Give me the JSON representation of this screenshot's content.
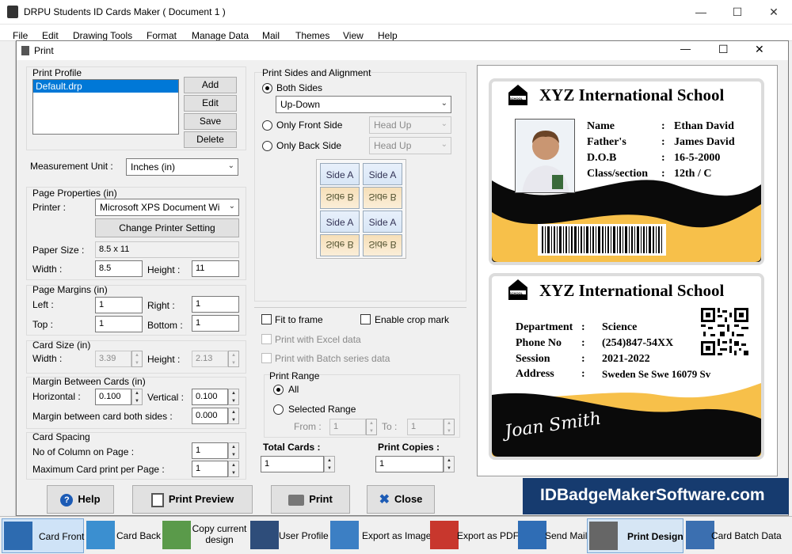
{
  "window": {
    "title": "DRPU Students ID Cards Maker ( Document 1 )"
  },
  "menu": [
    "File",
    "Edit",
    "Drawing Tools",
    "Format",
    "Manage Data",
    "Mail",
    "Themes",
    "View",
    "Help"
  ],
  "dialog": {
    "title": "Print"
  },
  "print_profile": {
    "label": "Print Profile",
    "items": [
      "Default.drp"
    ],
    "add": "Add",
    "edit": "Edit",
    "save": "Save",
    "delete": "Delete"
  },
  "measurement": {
    "label": "Measurement Unit :",
    "value": "Inches (in)"
  },
  "page_props": {
    "label": "Page Properties (in)",
    "printer_label": "Printer :",
    "printer": "Microsoft XPS Document Wi",
    "change": "Change Printer Setting",
    "paper_label": "Paper Size :",
    "paper": "8.5 x 11",
    "width_label": "Width :",
    "width": "8.5",
    "height_label": "Height :",
    "height": "11"
  },
  "margins": {
    "label": "Page Margins (in)",
    "left_label": "Left :",
    "left": "1",
    "right_label": "Right :",
    "right": "1",
    "top_label": "Top :",
    "top": "1",
    "bottom_label": "Bottom :",
    "bottom": "1"
  },
  "card_size": {
    "label": "Card Size (in)",
    "width_label": "Width :",
    "width": "3.39",
    "height_label": "Height :",
    "height": "2.13"
  },
  "between": {
    "label": "Margin Between Cards (in)",
    "h_label": "Horizontal :",
    "h": "0.100",
    "v_label": "Vertical :",
    "v": "0.100",
    "both_label": "Margin between card both sides :",
    "both": "0.000"
  },
  "spacing": {
    "label": "Card Spacing",
    "cols_label": "No of Column on Page :",
    "cols": "1",
    "max_label": "Maximum Card print per Page :",
    "max": "1"
  },
  "sides": {
    "label": "Print Sides and Alignment",
    "both": "Both Sides",
    "both_combo": "Up-Down",
    "front": "Only Front Side",
    "front_combo": "Head Up",
    "back": "Only Back Side",
    "back_combo": "Head Up",
    "tile_a": "Side A",
    "tile_b": "Side B"
  },
  "options": {
    "fit": "Fit to frame",
    "crop": "Enable crop mark",
    "excel": "Print with Excel data",
    "batch": "Print with Batch series data"
  },
  "range": {
    "label": "Print Range",
    "all": "All",
    "selected": "Selected Range",
    "from_label": "From :",
    "from": "1",
    "to_label": "To :",
    "to": "1"
  },
  "totals": {
    "cards_label": "Total Cards :",
    "cards": "1",
    "copies_label": "Print Copies :",
    "copies": "1"
  },
  "front": {
    "school": "XYZ International School",
    "badge": "SCHOOL",
    "rows": [
      [
        "Name",
        ":",
        "Ethan David"
      ],
      [
        "Father's",
        ":",
        "James David"
      ],
      [
        "D.O.B",
        ":",
        "16-5-2000"
      ],
      [
        "Class/section",
        ":",
        "12th / C"
      ]
    ]
  },
  "back": {
    "school": "XYZ International School",
    "badge": "SCHOOL",
    "rows": [
      [
        "Department",
        ":",
        "Science"
      ],
      [
        "Phone No",
        ":",
        "(254)847-54XX"
      ],
      [
        "Session",
        ":",
        "2021-2022"
      ],
      [
        "Address",
        ":",
        "Sweden Se Swe 16079 Sv"
      ]
    ],
    "signature": "Joan Smith"
  },
  "buttons": {
    "help": "Help",
    "preview": "Print Preview",
    "print": "Print",
    "close": "Close"
  },
  "banner": "IDBadgeMakerSoftware.com",
  "toolbar": [
    "Card Front",
    "Card Back",
    "Copy current design",
    "User Profile",
    "Export as Image",
    "Export as PDF",
    "Send Mail",
    "Print Design",
    "Card Batch Data"
  ],
  "colors": {
    "accent": "#f7c04a",
    "banner": "#163b6f",
    "card_dark": "#0a0a0a"
  }
}
